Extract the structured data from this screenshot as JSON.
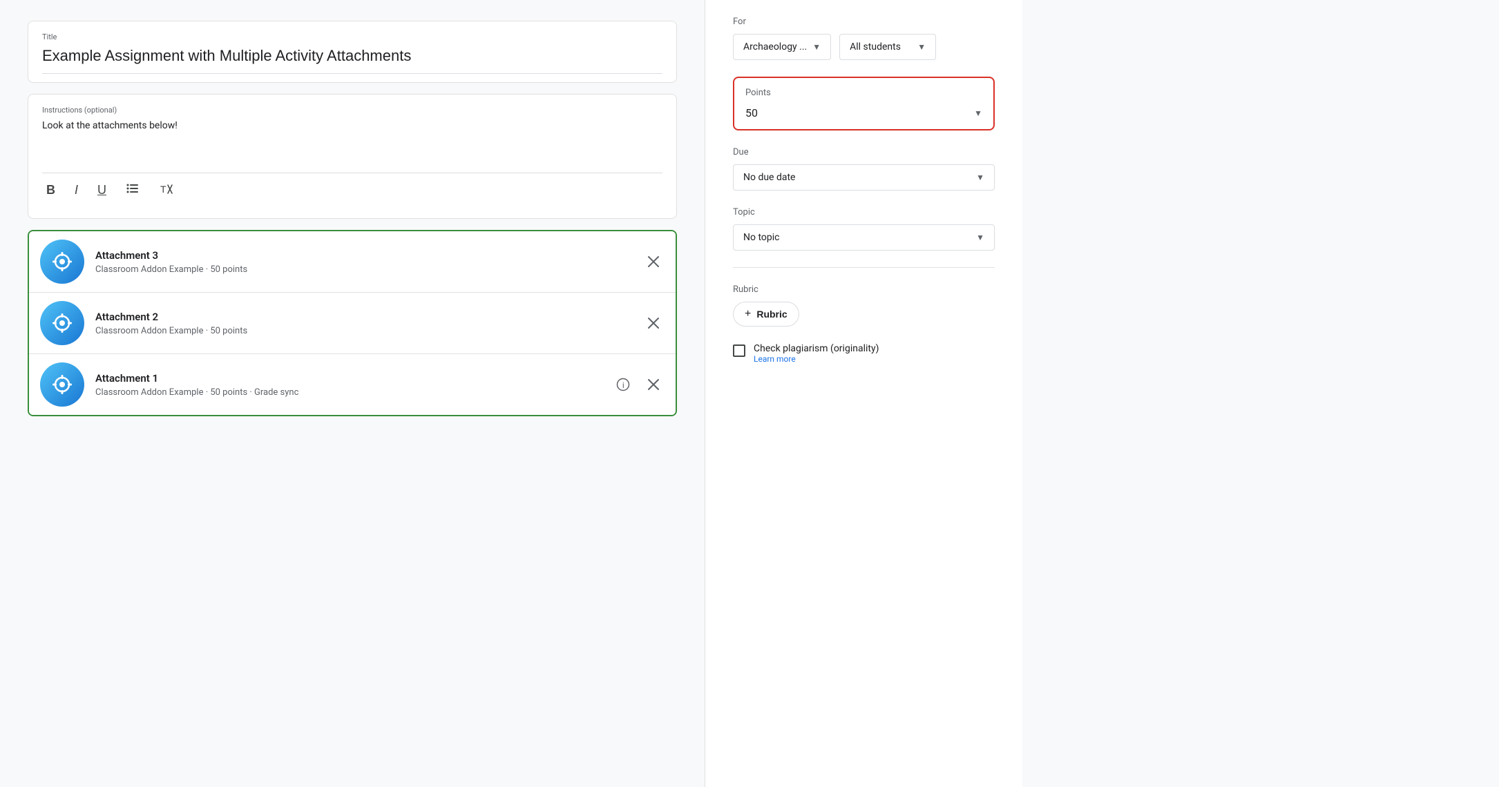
{
  "title": {
    "label": "Title",
    "value": "Example Assignment with Multiple Activity Attachments"
  },
  "instructions": {
    "label": "Instructions (optional)",
    "value": "Look at the attachments below!"
  },
  "toolbar": {
    "bold": "B",
    "italic": "I",
    "underline": "U",
    "list": "≡",
    "clear": "✕"
  },
  "attachments": [
    {
      "name": "Attachment 3",
      "subtitle": "Classroom Addon Example · 50 points",
      "hasInfo": false
    },
    {
      "name": "Attachment 2",
      "subtitle": "Classroom Addon Example · 50 points",
      "hasInfo": false
    },
    {
      "name": "Attachment 1",
      "subtitle": "Classroom Addon Example · 50 points · Grade sync",
      "hasInfo": true
    }
  ],
  "sidebar": {
    "for_label": "For",
    "class_dropdown": "Archaeology ...",
    "students_dropdown": "All students",
    "points_label": "Points",
    "points_value": "50",
    "due_label": "Due",
    "due_value": "No due date",
    "topic_label": "Topic",
    "topic_value": "No topic",
    "rubric_label": "Rubric",
    "rubric_button": "Rubric",
    "plagiarism_label": "Check plagiarism (originality)",
    "learn_more": "Learn more"
  }
}
